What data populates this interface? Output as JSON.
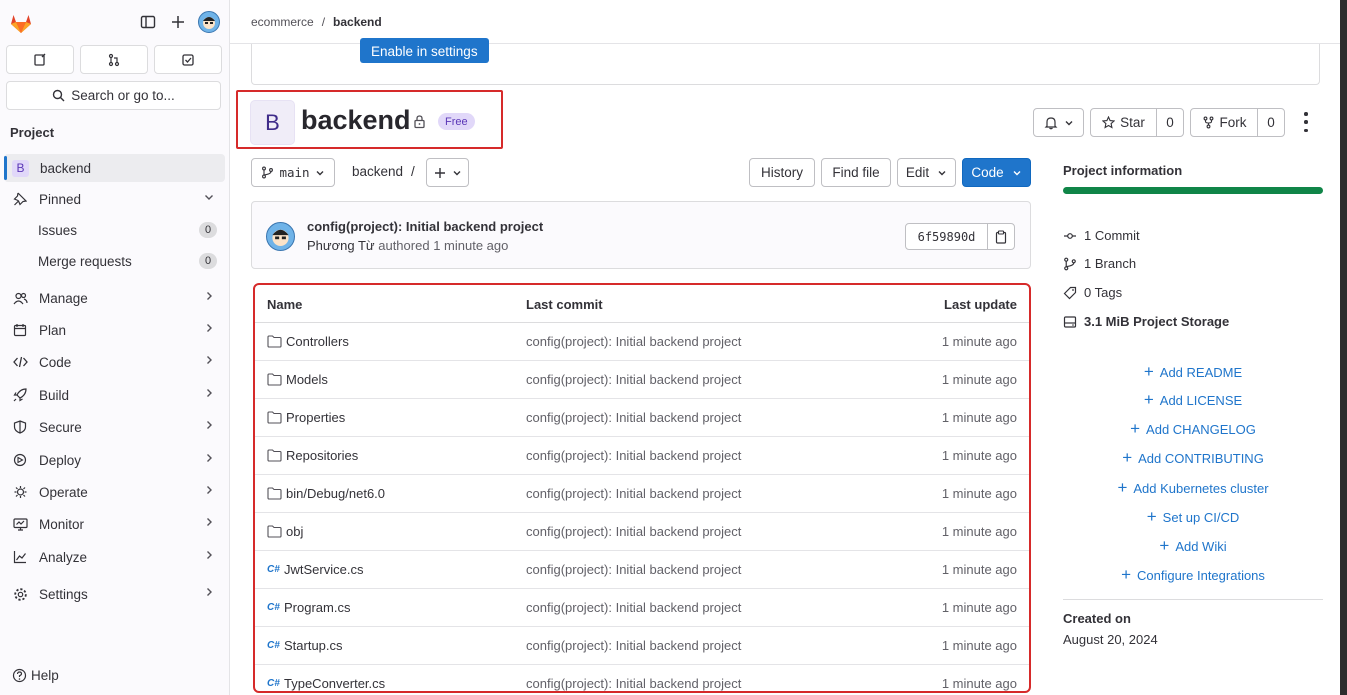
{
  "breadcrumb": {
    "group": "ecommerce",
    "separator": "/",
    "project": "backend"
  },
  "sidebar": {
    "search_label": "Search or go to...",
    "section": "Project",
    "project_item": {
      "badge": "B",
      "label": "backend"
    },
    "pinned_label": "Pinned",
    "pinned_items": [
      {
        "label": "Issues",
        "count": "0"
      },
      {
        "label": "Merge requests",
        "count": "0"
      }
    ],
    "nav": [
      {
        "label": "Manage",
        "icon": "users-icon"
      },
      {
        "label": "Plan",
        "icon": "calendar-icon"
      },
      {
        "label": "Code",
        "icon": "code-icon"
      },
      {
        "label": "Build",
        "icon": "rocket-icon"
      },
      {
        "label": "Secure",
        "icon": "shield-icon"
      },
      {
        "label": "Deploy",
        "icon": "deploy-icon"
      },
      {
        "label": "Operate",
        "icon": "cloud-icon"
      },
      {
        "label": "Monitor",
        "icon": "monitor-icon"
      },
      {
        "label": "Analyze",
        "icon": "chart-icon"
      }
    ],
    "settings_label": "Settings",
    "help_label": "Help"
  },
  "banner": {
    "button_label": "Enable in settings"
  },
  "project": {
    "avatar_letter": "B",
    "title": "backend",
    "tier_badge": "Free",
    "star_label": "Star",
    "star_count": "0",
    "fork_label": "Fork",
    "fork_count": "0"
  },
  "toolbar": {
    "branch": "main",
    "path": "backend",
    "path_sep": "/",
    "history": "History",
    "find_file": "Find file",
    "edit": "Edit",
    "code": "Code"
  },
  "last_commit": {
    "title": "config(project): Initial backend project",
    "author": "Phương Từ",
    "authored": "authored",
    "time": "1 minute ago",
    "sha": "6f59890d"
  },
  "file_table": {
    "headers": {
      "name": "Name",
      "commit": "Last commit",
      "update": "Last update"
    },
    "rows": [
      {
        "name": "Controllers",
        "type": "folder",
        "commit": "config(project): Initial backend project",
        "update": "1 minute ago"
      },
      {
        "name": "Models",
        "type": "folder",
        "commit": "config(project): Initial backend project",
        "update": "1 minute ago"
      },
      {
        "name": "Properties",
        "type": "folder",
        "commit": "config(project): Initial backend project",
        "update": "1 minute ago"
      },
      {
        "name": "Repositories",
        "type": "folder",
        "commit": "config(project): Initial backend project",
        "update": "1 minute ago"
      },
      {
        "name": "bin/Debug/net6.0",
        "type": "folder",
        "commit": "config(project): Initial backend project",
        "update": "1 minute ago"
      },
      {
        "name": "obj",
        "type": "folder",
        "commit": "config(project): Initial backend project",
        "update": "1 minute ago"
      },
      {
        "name": "JwtService.cs",
        "type": "csharp",
        "commit": "config(project): Initial backend project",
        "update": "1 minute ago"
      },
      {
        "name": "Program.cs",
        "type": "csharp",
        "commit": "config(project): Initial backend project",
        "update": "1 minute ago"
      },
      {
        "name": "Startup.cs",
        "type": "csharp",
        "commit": "config(project): Initial backend project",
        "update": "1 minute ago"
      },
      {
        "name": "TypeConverter.cs",
        "type": "csharp",
        "commit": "config(project): Initial backend project",
        "update": "1 minute ago"
      }
    ]
  },
  "project_info": {
    "title": "Project information",
    "stats": [
      {
        "value": "1",
        "label": "Commit",
        "bold": false
      },
      {
        "value": "1",
        "label": "Branch",
        "bold": false
      },
      {
        "value": "0",
        "label": "Tags",
        "bold": false
      },
      {
        "value": "3.1 MiB",
        "label": "Project Storage",
        "bold": true
      }
    ],
    "actions": [
      "Add README",
      "Add LICENSE",
      "Add CHANGELOG",
      "Add CONTRIBUTING",
      "Add Kubernetes cluster",
      "Set up CI/CD",
      "Add Wiki",
      "Configure Integrations"
    ],
    "created_label": "Created on",
    "created_value": "August 20, 2024"
  },
  "colors": {
    "accent": "#1f75cb",
    "highlight_border": "#d62a2a",
    "storage_bar": "#108548"
  }
}
